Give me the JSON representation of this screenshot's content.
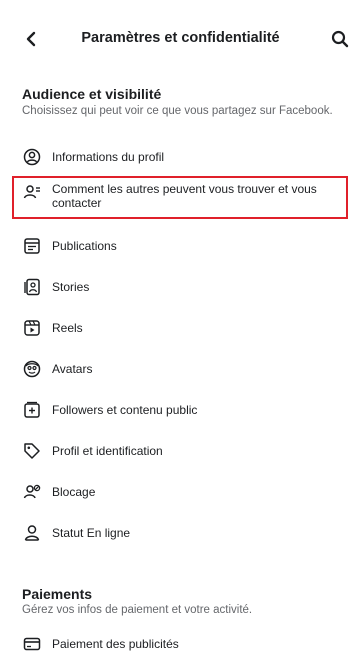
{
  "header": {
    "title": "Paramètres et confidentialité",
    "back_icon": "chevron-left-icon",
    "search_icon": "search-icon"
  },
  "audience": {
    "title": "Audience et visibilité",
    "description": "Choisissez qui peut voir ce que vous partagez sur Facebook.",
    "items": [
      {
        "label": "Informations du profil",
        "icon": "profile-circle-icon"
      },
      {
        "label": "Comment les autres peuvent vous trouver et vous contacter",
        "icon": "find-contact-icon",
        "highlighted": true
      },
      {
        "label": "Publications",
        "icon": "publications-icon"
      },
      {
        "label": "Stories",
        "icon": "stories-icon"
      },
      {
        "label": "Reels",
        "icon": "reels-icon"
      },
      {
        "label": "Avatars",
        "icon": "avatar-icon"
      },
      {
        "label": "Followers et contenu public",
        "icon": "followers-icon"
      },
      {
        "label": "Profil et identification",
        "icon": "tag-icon"
      },
      {
        "label": "Blocage",
        "icon": "block-user-icon"
      },
      {
        "label": "Statut En ligne",
        "icon": "online-status-icon"
      }
    ]
  },
  "payments": {
    "title": "Paiements",
    "description": "Gérez vos infos de paiement et votre activité.",
    "items": [
      {
        "label": "Paiement des publicités",
        "icon": "card-icon"
      }
    ]
  },
  "colors": {
    "highlight": "#e0202a",
    "text": "#1c1e21",
    "secondary": "#65676b"
  }
}
